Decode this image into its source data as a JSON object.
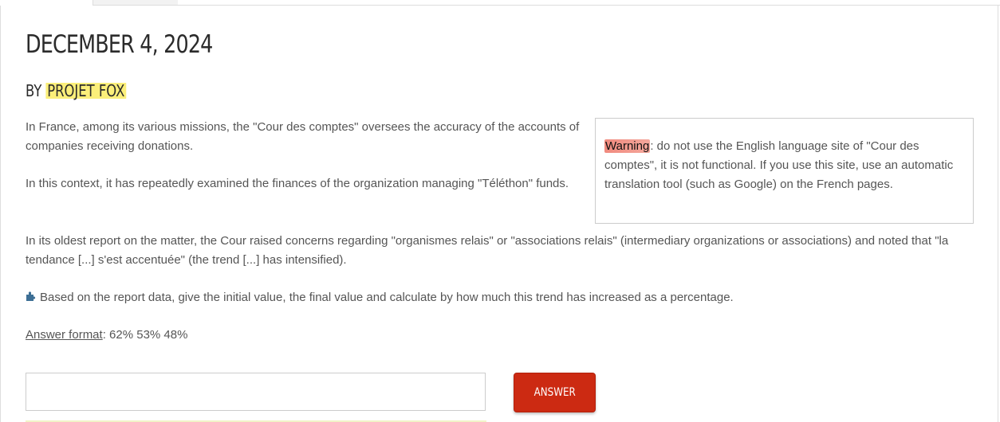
{
  "page": {
    "date_heading": "DECEMBER 4, 2024",
    "byline_prefix": "BY",
    "author": "PROJET FOX"
  },
  "paragraphs": {
    "p1": "In France, among its various missions, the \"Cour des comptes\" oversees the accuracy of the accounts of companies receiving donations.",
    "p2": "In this context, it has repeatedly examined the finances of the organization managing \"Téléthon\" funds.",
    "p3": "In its oldest report on the matter, the Cour raised concerns regarding \"organismes relais\" or \"associations relais\" (intermediary organizations or associations) and noted that \"la tendance [...] s'est accentuée\" (the trend [...] has intensified).",
    "question": "Based on the report data, give the initial value, the final value and calculate by how much this trend has increased as a percentage.",
    "format_label": "Answer format",
    "format_value": ": 62% 53% 48%"
  },
  "warning": {
    "label": "Warning",
    "text": ": do not use the English language site of \"Cour des comptes\", it is not functional. If you use this site, use an automatic translation tool (such as Google) on the French pages."
  },
  "answer_form": {
    "input_value": "",
    "input_placeholder": "",
    "button_label": "ANSWER"
  },
  "colors": {
    "author_highlight": "#fbef7a",
    "warning_highlight": "#f08a7e",
    "button": "#cc2a12",
    "puzzle_icon": "#3d6f95"
  },
  "icons": {
    "question_icon": "puzzle-icon"
  }
}
